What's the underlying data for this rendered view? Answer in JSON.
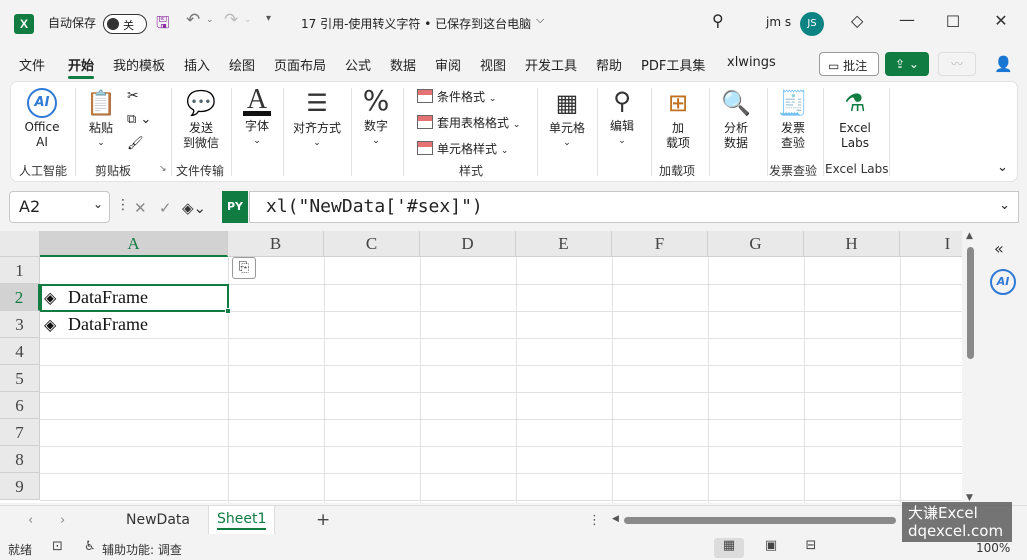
{
  "titlebar": {
    "autosave_label": "自动保存",
    "autosave_state": "关",
    "doc_title": "17 引用-使用转义字符 • 已保存到这台电脑",
    "user_name": "jm s",
    "avatar_initials": "JS",
    "logo_letter": "X"
  },
  "tabs": [
    "文件",
    "开始",
    "我的模板",
    "插入",
    "绘图",
    "页面布局",
    "公式",
    "数据",
    "审阅",
    "视图",
    "开发工具",
    "帮助",
    "PDF工具集",
    "xlwings"
  ],
  "active_tab": "开始",
  "comment_label": "批注",
  "ribbon": {
    "office_ai_line1": "Office",
    "office_ai_line2": "AI",
    "ai_glyph": "AI",
    "paste_label": "粘贴",
    "send_line1": "发送",
    "send_line2": "到微信",
    "font_label": "字体",
    "font_glyph": "A",
    "align_label": "对齐方式",
    "number_label": "数字",
    "number_glyph": "%",
    "conditional_format": "条件格式",
    "table_format": "套用表格格式",
    "cell_style": "单元格样式",
    "cells_label": "单元格",
    "edit_label": "编辑",
    "addin_line1": "加",
    "addin_line2": "载项",
    "analyze_line1": "分析",
    "analyze_line2": "数据",
    "invoice_line1": "发票",
    "invoice_line2": "查验",
    "labs_line1": "Excel",
    "labs_line2": "Labs",
    "groups": {
      "ai": "人工智能",
      "clipboard": "剪贴板",
      "file_transfer": "文件传输",
      "styles": "样式",
      "addins": "加载项",
      "invoice": "发票查验",
      "labs": "Excel Labs"
    }
  },
  "formula_bar": {
    "name_box": "A2",
    "py_badge": "PY",
    "formula": "xl(\"NewData['#sex]\")"
  },
  "grid": {
    "columns": [
      "A",
      "B",
      "C",
      "D",
      "E",
      "F",
      "G",
      "H",
      "I"
    ],
    "rows": [
      "1",
      "2",
      "3",
      "4",
      "5",
      "6",
      "7",
      "8",
      "9"
    ],
    "cells": {
      "A2": "DataFrame",
      "A3": "DataFrame"
    },
    "selected_cell": "A2"
  },
  "sheets": [
    "NewData",
    "Sheet1"
  ],
  "active_sheet": "Sheet1",
  "status": {
    "ready": "就绪",
    "accessibility": "辅助功能: 调查",
    "zoom": "100%"
  },
  "watermark": {
    "line1": "大谦Excel",
    "line2": "dqexcel.com"
  },
  "colors": {
    "accent": "#107c41",
    "ai_blue": "#2f7ad6",
    "avatar": "#0c8484"
  }
}
